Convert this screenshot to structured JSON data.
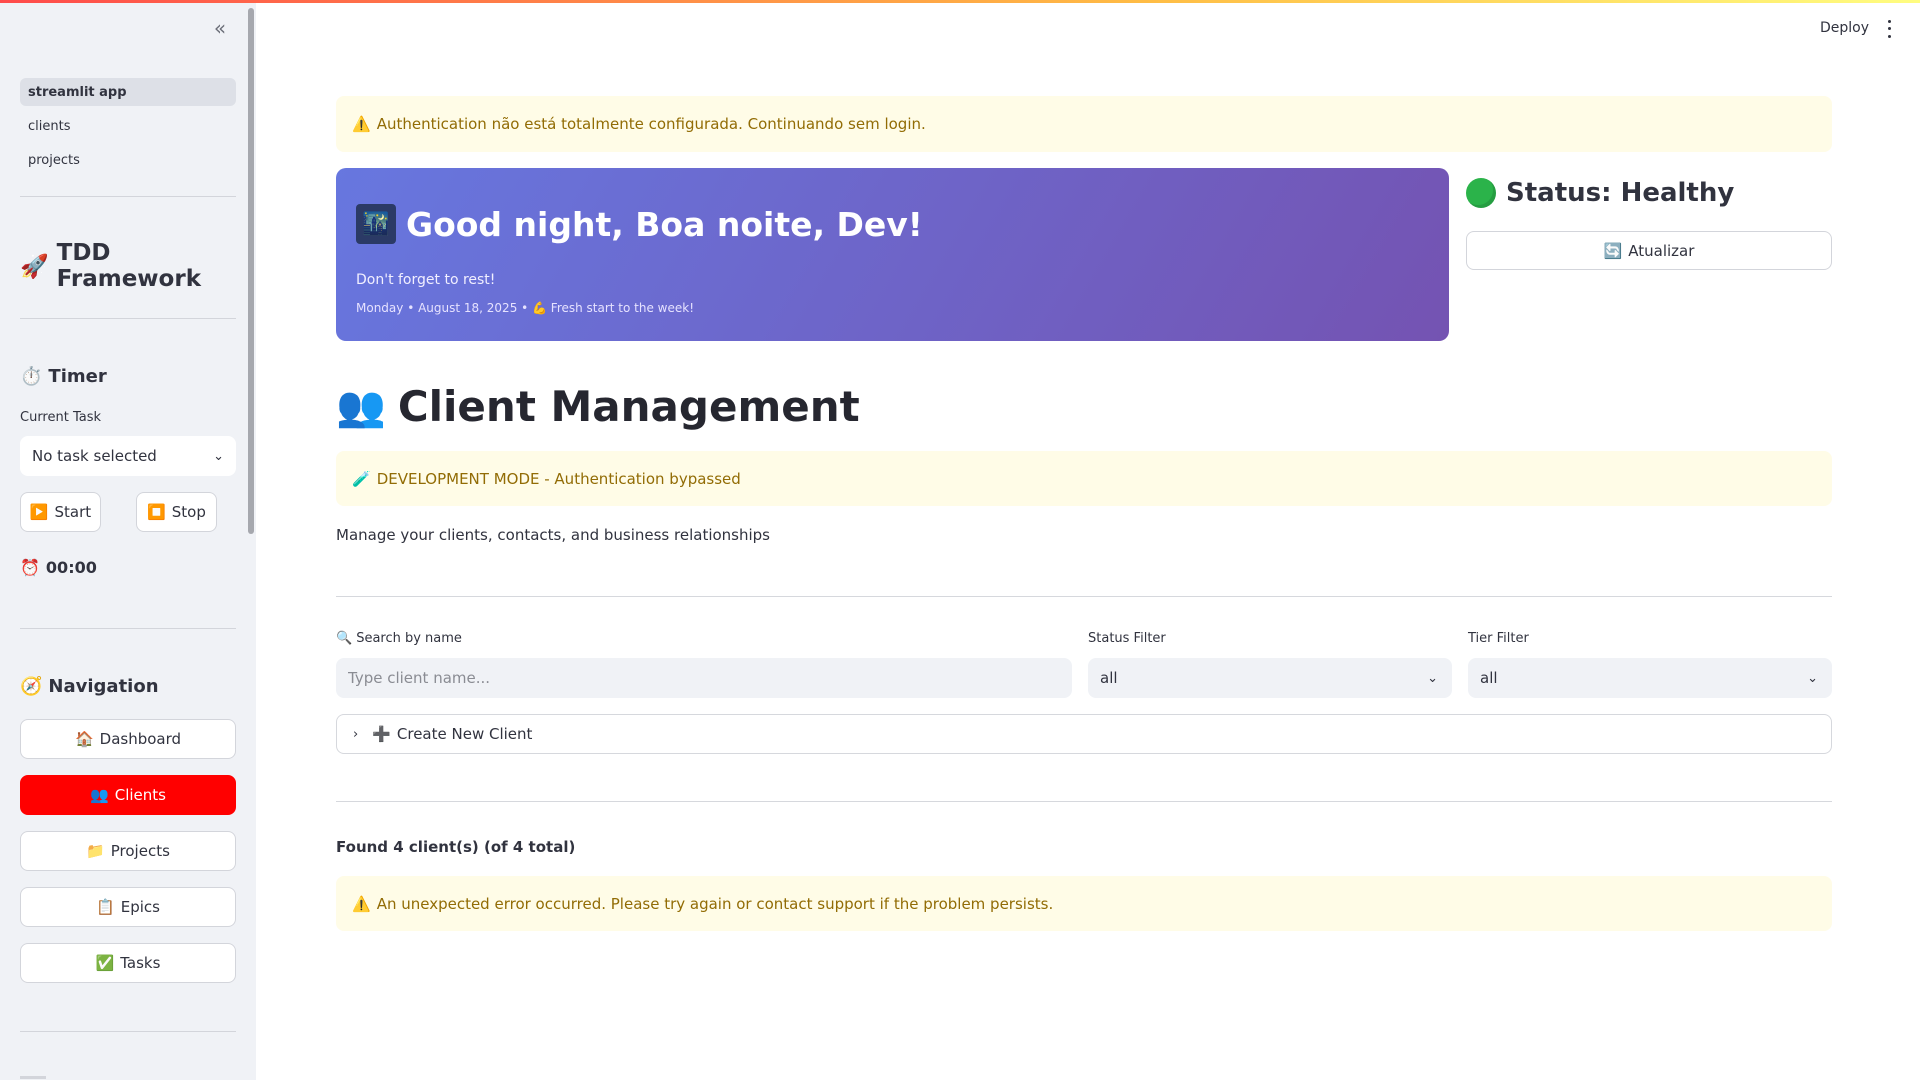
{
  "sidebar": {
    "collapse_icon": "double-chevron-left-icon",
    "app_pages": [
      {
        "label": "streamlit app",
        "active": true
      },
      {
        "label": "clients",
        "active": false
      },
      {
        "label": "projects",
        "active": false
      }
    ],
    "brand": {
      "icon": "🚀",
      "title": "TDD Framework"
    },
    "timer": {
      "icon": "⏱️",
      "title": "Timer",
      "current_task_label": "Current Task",
      "task_select_value": "No task selected",
      "start_icon": "▶️",
      "start_label": "Start",
      "stop_icon": "⏹️",
      "stop_label": "Stop",
      "clock_icon": "⏰",
      "time": "00:00"
    },
    "navigation": {
      "icon": "🧭",
      "title": "Navigation",
      "items": [
        {
          "icon": "🏠",
          "label": "Dashboard"
        },
        {
          "icon": "👥",
          "label": "Clients",
          "active": true
        },
        {
          "icon": "📁",
          "label": "Projects"
        },
        {
          "icon": "📋",
          "label": "Epics"
        },
        {
          "icon": "✅",
          "label": "Tasks"
        }
      ]
    }
  },
  "header": {
    "deploy_label": "Deploy",
    "menu_icon": "vertical-dots-icon"
  },
  "main": {
    "auth_warning": {
      "icon": "⚠️",
      "text": "Authentication não está totalmente configurada. Continuando sem login."
    },
    "greeting": {
      "emoji": "🌃",
      "title": "Good night, Boa noite, Dev!",
      "subtitle": "Don't forget to rest!",
      "date_line": "Monday • August 18, 2025 • 💪 Fresh start to the week!"
    },
    "status": {
      "title": "Status: Healthy",
      "color": "#2bb34a"
    },
    "refresh_button": {
      "icon": "🔄",
      "label": "Atualizar"
    },
    "page_title": {
      "icon": "👥",
      "text": "Client Management"
    },
    "dev_mode": {
      "icon": "🧪",
      "text": "DEVELOPMENT MODE - Authentication bypassed"
    },
    "caption": "Manage your clients, contacts, and business relationships",
    "filters": {
      "search_icon": "🔍",
      "search_label": "Search by name",
      "search_placeholder": "Type client name...",
      "status_label": "Status Filter",
      "status_value": "all",
      "tier_label": "Tier Filter",
      "tier_value": "all"
    },
    "create_expander": {
      "icon": "➕",
      "label": "Create New Client"
    },
    "found_text": "Found 4 client(s) (of 4 total)",
    "error_alert": {
      "icon": "⚠️",
      "text": "An unexpected error occurred. Please try again or contact support if the problem persists."
    }
  },
  "colors": {
    "primary": "#ff0000",
    "sidebar_bg": "#f0f2f6",
    "warning_bg": "#fffce7",
    "warning_text": "#926c05",
    "hero_start": "#6777df",
    "hero_end": "#7453b2"
  }
}
